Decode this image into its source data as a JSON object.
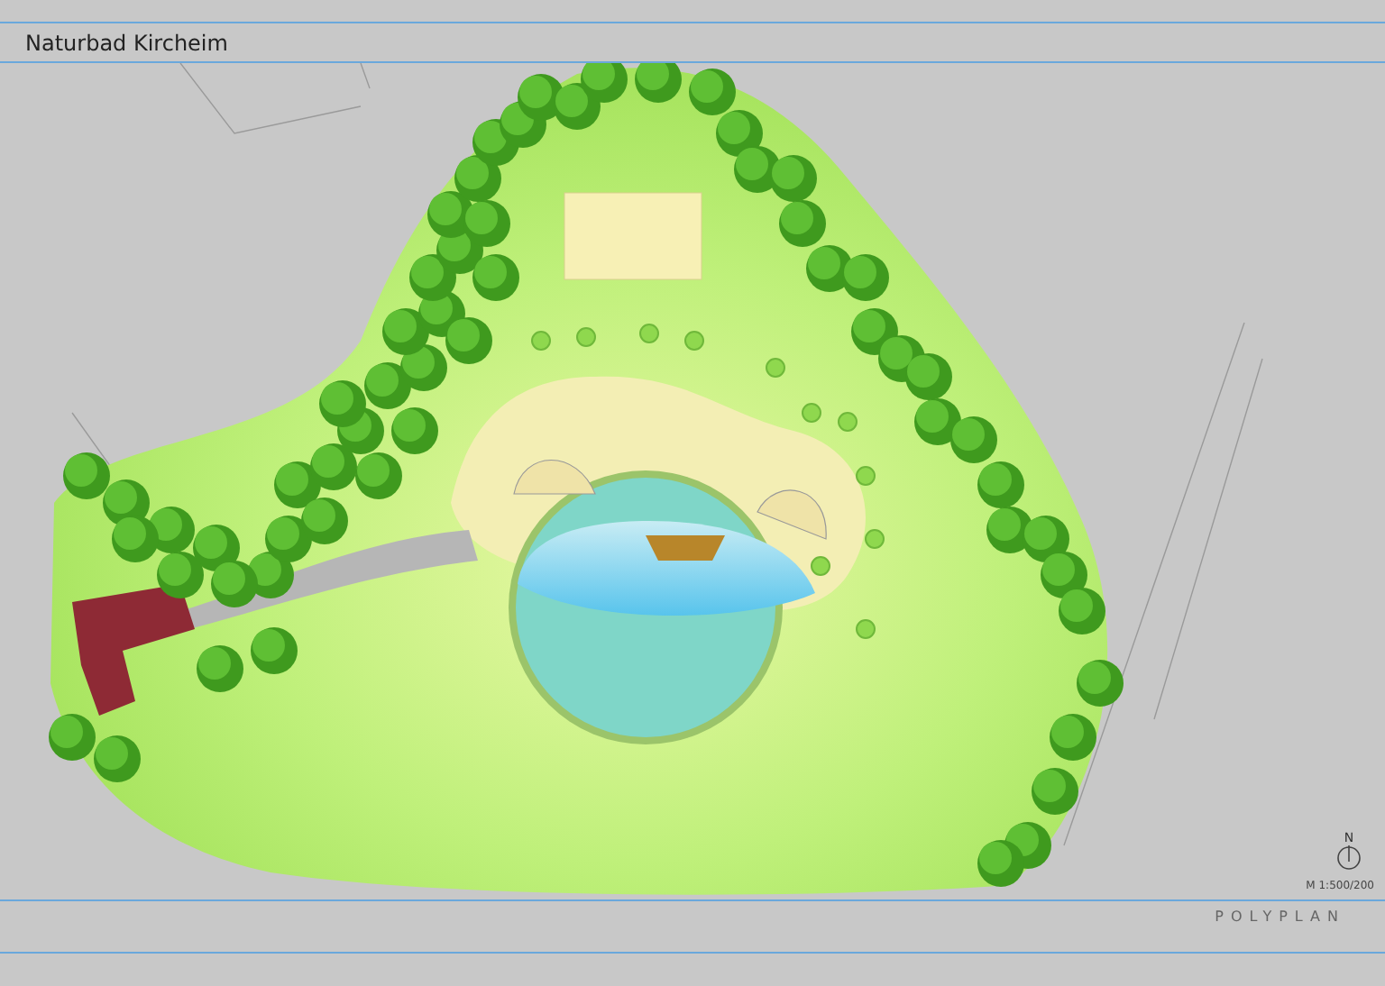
{
  "header": {
    "title": "Naturbad Kircheim"
  },
  "plan": {
    "north_label": "N",
    "scale": "M 1:500/200"
  },
  "footer": {
    "logo": "POLYPLAN"
  }
}
